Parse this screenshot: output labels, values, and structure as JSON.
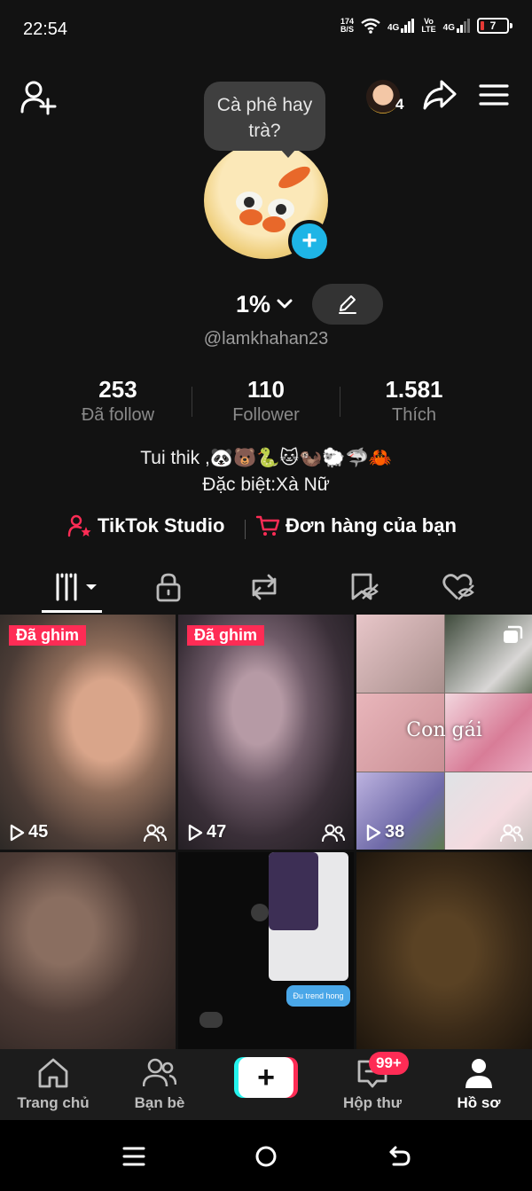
{
  "status_bar": {
    "time": "22:54",
    "net_speed": "174",
    "net_speed_unit": "B/S",
    "sim1_label": "4G",
    "volte_top": "Vo",
    "volte_bottom": "LTE",
    "sim2_label": "4G",
    "battery_level": "7",
    "battery_color": "#e53935"
  },
  "header": {
    "add_friend_icon": "add-user-icon",
    "friend_count": "4",
    "share_icon": "share-icon",
    "menu_icon": "menu-icon"
  },
  "profile": {
    "bubble_text": "Cà phê hay trà?",
    "display_name": "1%",
    "username": "@lamkhahan23",
    "stats": [
      {
        "value": "253",
        "label": "Đã follow"
      },
      {
        "value": "110",
        "label": "Follower"
      },
      {
        "value": "1.581",
        "label": "Thích"
      }
    ],
    "bio_line1": "Tui thik ,🐼🐻🐍🐱🦦🐑🦈🦀",
    "bio_line2": "Đặc biệt:Xà Nữ"
  },
  "links": {
    "studio": "TikTok Studio",
    "orders": "Đơn hàng của bạn"
  },
  "tabs": [
    {
      "icon": "videos-grid-icon",
      "active": true
    },
    {
      "icon": "lock-icon"
    },
    {
      "icon": "repost-icon"
    },
    {
      "icon": "favorites-hidden-icon"
    },
    {
      "icon": "liked-hidden-icon"
    }
  ],
  "videos": [
    {
      "pinned_label": "Đã ghim",
      "views": "45",
      "overlay": "",
      "caption": ""
    },
    {
      "pinned_label": "Đã ghim",
      "views": "47",
      "overlay": "",
      "caption": ""
    },
    {
      "pinned_label": "",
      "views": "38",
      "overlay": "",
      "caption": "Con gái"
    },
    {
      "pinned_label": "",
      "views": "",
      "overlay": "",
      "caption": ""
    },
    {
      "pinned_label": "",
      "views": "",
      "overlay": "",
      "caption": "Đu trend hong"
    },
    {
      "pinned_label": "",
      "views": "",
      "overlay": "",
      "caption": ""
    }
  ],
  "bottom_nav": {
    "home": "Trang chủ",
    "friends": "Bạn bè",
    "inbox": "Hộp thư",
    "inbox_badge": "99+",
    "profile": "Hồ sơ"
  },
  "colors": {
    "accent_red": "#fe2c55",
    "accent_cyan": "#25f4ee",
    "plus_badge": "#1eb5e6"
  }
}
